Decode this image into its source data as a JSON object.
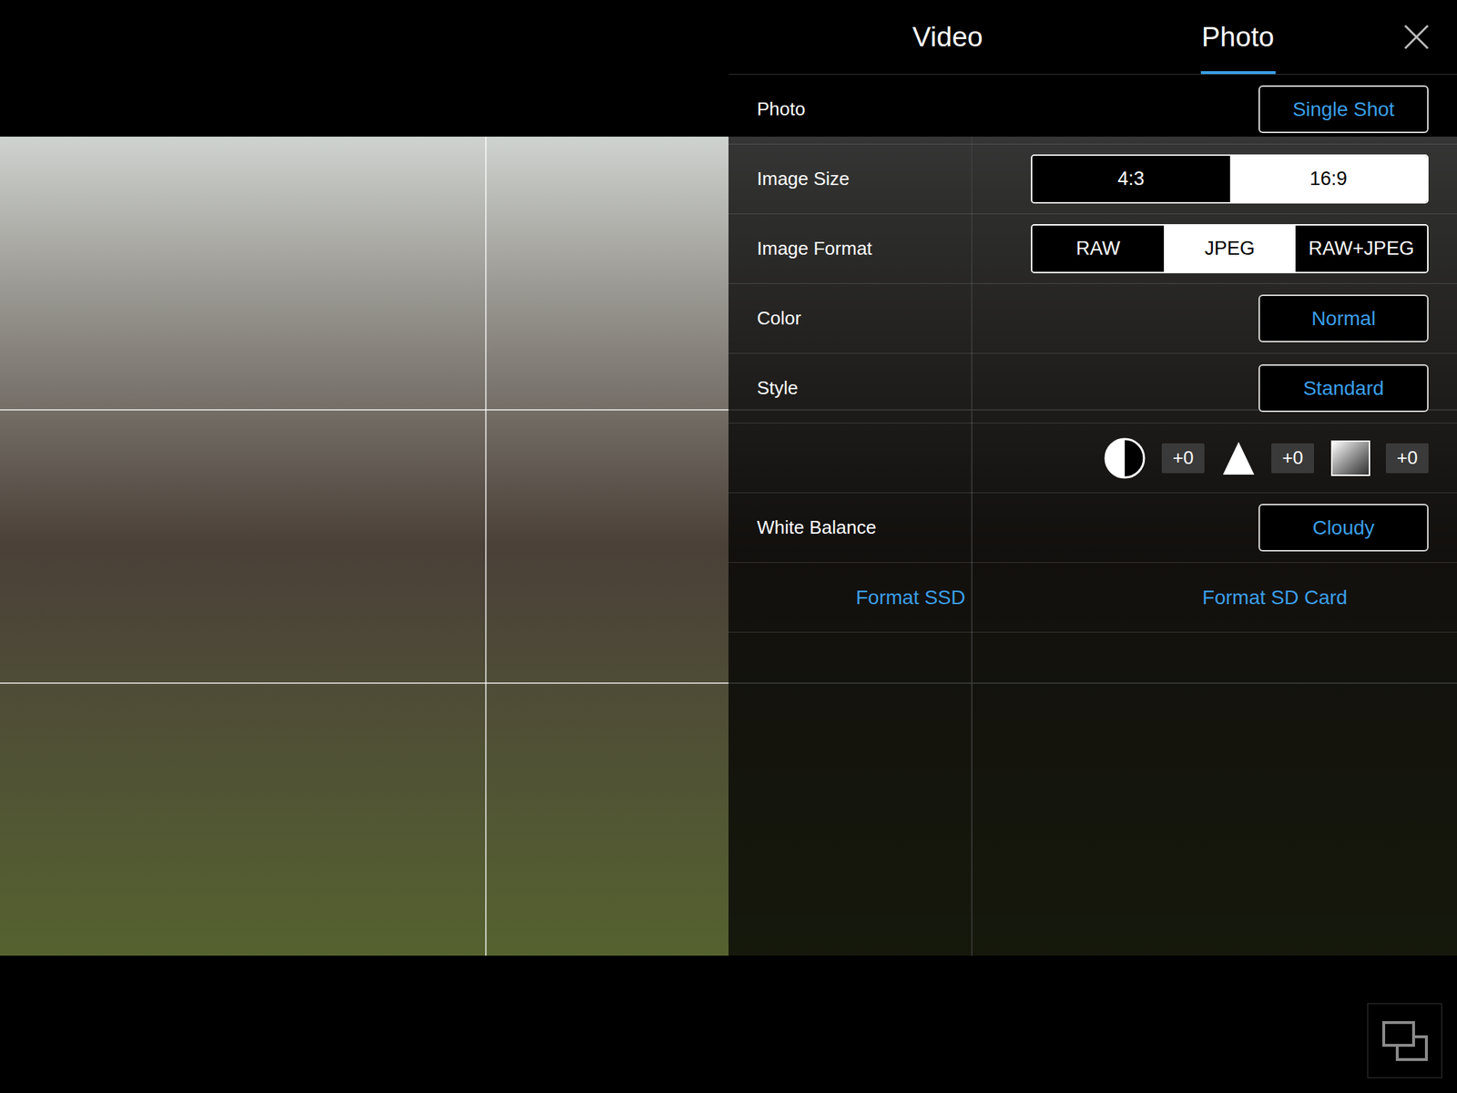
{
  "tabs": [
    {
      "label": "Video",
      "selected": false
    },
    {
      "label": "Photo",
      "selected": true
    }
  ],
  "settings": [
    {
      "kind": "button",
      "label": "Photo",
      "value": "Single Shot"
    },
    {
      "kind": "segmented",
      "label": "Image Size",
      "options": [
        {
          "label": "4:3",
          "selected": false
        },
        {
          "label": "16:9",
          "selected": true
        }
      ]
    },
    {
      "kind": "segmented",
      "label": "Image Format",
      "options": [
        {
          "label": "RAW",
          "selected": false
        },
        {
          "label": "JPEG",
          "selected": true
        },
        {
          "label": "RAW+JPEG",
          "selected": false
        }
      ]
    },
    {
      "kind": "button",
      "label": "Color",
      "value": "Normal"
    },
    {
      "kind": "button",
      "label": "Style",
      "value": "Standard"
    },
    {
      "kind": "params",
      "params": [
        {
          "kind": "contrast",
          "value": "+0"
        },
        {
          "kind": "sharpness",
          "value": "+0"
        },
        {
          "kind": "saturation",
          "value": "+0"
        }
      ]
    },
    {
      "kind": "button",
      "label": "White Balance",
      "value": "Cloudy"
    },
    {
      "kind": "actions",
      "actions": [
        "Format SSD",
        "Format SD Card"
      ]
    }
  ]
}
